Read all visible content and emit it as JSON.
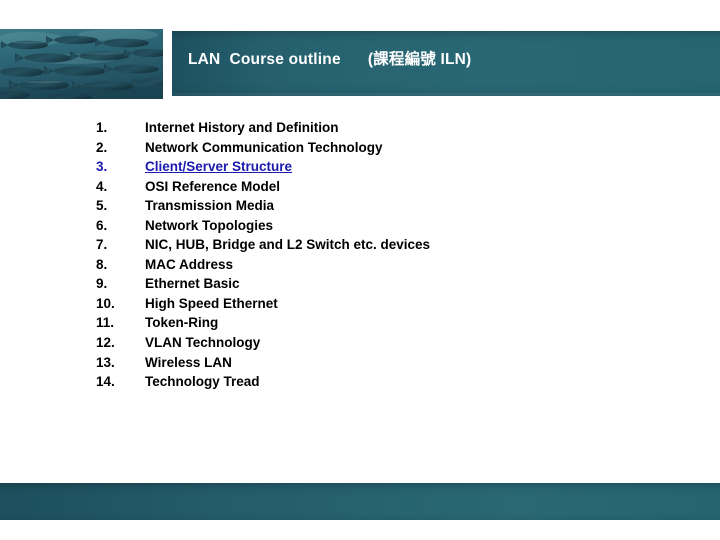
{
  "slide": {
    "background_color": "#ffffff",
    "accent_color": "#26606e",
    "link_color": "#1a1ab0",
    "text_color": "#000000"
  },
  "header": {
    "title": "LAN  Course outline      (課程編號 ILN)",
    "band_color": "#26606e",
    "photo_alt": "school-of-fish-underwater-photo"
  },
  "footer": {
    "band_color": "#245c6a"
  },
  "outline": {
    "items": [
      {
        "number": "1.",
        "label": "Internet History and Definition",
        "is_link": false
      },
      {
        "number": "2.",
        "label": "Network Communication Technology",
        "is_link": false
      },
      {
        "number": "3.",
        "label": "Client/Server Structure",
        "is_link": true
      },
      {
        "number": "4.",
        "label": "OSI Reference Model",
        "is_link": false
      },
      {
        "number": "5.",
        "label": "Transmission Media",
        "is_link": false
      },
      {
        "number": "6.",
        "label": "Network Topologies",
        "is_link": false
      },
      {
        "number": "7.",
        "label": "NIC, HUB, Bridge and L2 Switch etc. devices",
        "is_link": false
      },
      {
        "number": "8.",
        "label": "MAC Address",
        "is_link": false
      },
      {
        "number": "9.",
        "label": "Ethernet Basic",
        "is_link": false
      },
      {
        "number": "10.",
        "label": "High Speed Ethernet",
        "is_link": false
      },
      {
        "number": "11.",
        "label": "Token-Ring",
        "is_link": false
      },
      {
        "number": "12.",
        "label": "VLAN Technology",
        "is_link": false
      },
      {
        "number": "13.",
        "label": "Wireless LAN",
        "is_link": false
      },
      {
        "number": "14.",
        "label": "Technology Tread",
        "is_link": false
      }
    ]
  }
}
